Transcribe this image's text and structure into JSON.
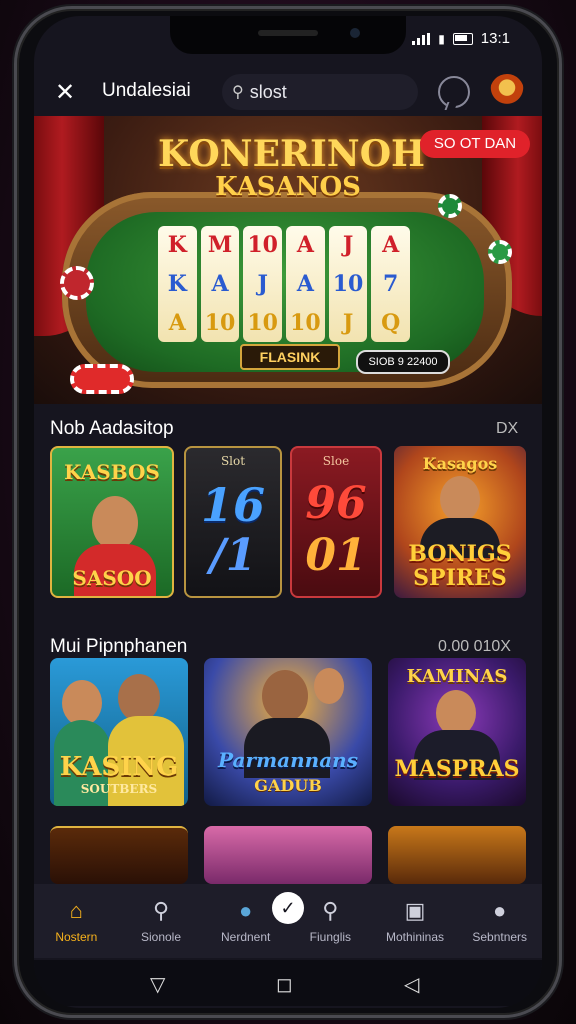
{
  "status_bar": {
    "time": "13:1"
  },
  "header": {
    "app_name": "Undalesiai",
    "search_value": "slost",
    "menu_icon": "close-x-icon",
    "chat_icon": "chat-bubble-icon",
    "profile_icon": "avatar-icon"
  },
  "hero": {
    "title": "KONERINOH",
    "subtitle": "KASANOS",
    "badge": "SO OT DAN",
    "reels": [
      [
        "K",
        "K",
        "A"
      ],
      [
        "M",
        "A",
        "10"
      ],
      [
        "10",
        "J",
        "10"
      ],
      [
        "A",
        "A",
        "10"
      ],
      [
        "J",
        "10",
        "J"
      ],
      [
        "A",
        "7",
        "Q"
      ]
    ],
    "table_label": "FLASINK",
    "table_amount": "SIOB 9 22400"
  },
  "section1": {
    "title": "Nob Aadasitop",
    "right": "DX",
    "cards": [
      {
        "title": "KASBOS",
        "caption": "SASOO"
      },
      {
        "title": "Slot",
        "numbers": "16",
        "sub": "/1"
      },
      {
        "title": "Sloe",
        "numbers": "96",
        "sub": "01"
      },
      {
        "title": "Kasagos",
        "caption": "BONIGS SPIRES"
      }
    ]
  },
  "section2": {
    "title": "Mui Pipnphanen",
    "right": "0.00 010X",
    "cards": [
      {
        "title": "KASING",
        "caption": "SOUTBERS"
      },
      {
        "title": "Parmannans",
        "caption": "GADUB"
      },
      {
        "title": "KAMINAS",
        "caption": "MASPRAS"
      }
    ]
  },
  "bottom_nav": [
    {
      "label": "Nostern",
      "icon": "home-icon",
      "active": true
    },
    {
      "label": "Sionole",
      "icon": "search-icon",
      "active": false
    },
    {
      "label": "Nerdnent",
      "icon": "rocket-icon",
      "active": false
    },
    {
      "label": "Fiunglis",
      "icon": "magnifier-icon",
      "active": false
    },
    {
      "label": "Mothininas",
      "icon": "cards-icon",
      "active": false
    },
    {
      "label": "Sebntners",
      "icon": "user-icon",
      "active": false
    }
  ],
  "colors": {
    "accent": "#f7b21c",
    "badge": "#e0222a",
    "background": "#16151f"
  }
}
